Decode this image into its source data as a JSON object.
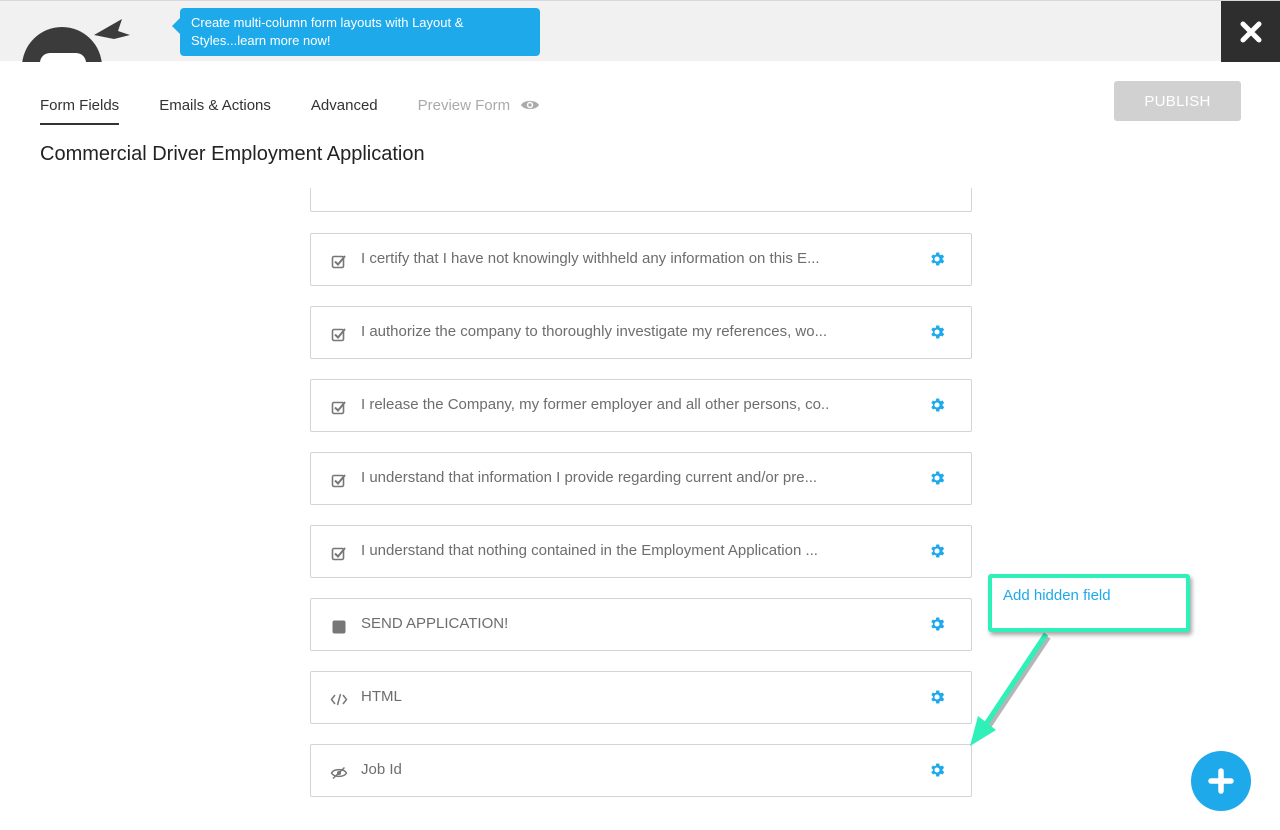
{
  "header": {
    "promo_text": "Create multi-column form layouts with Layout & Styles...learn more now!",
    "close_icon": "close-x-icon"
  },
  "tabs": [
    {
      "label": "Form Fields",
      "active": true
    },
    {
      "label": "Emails & Actions",
      "active": false
    },
    {
      "label": "Advanced",
      "active": false
    },
    {
      "label": "Preview Form",
      "active": false,
      "disabled": true,
      "icon": "eye-icon"
    }
  ],
  "publish_label": "PUBLISH",
  "form_title": "Commercial Driver Employment Application",
  "fields": [
    {
      "icon": "checkbox-icon",
      "label": "I certify that I have not knowingly withheld any information on this E..."
    },
    {
      "icon": "checkbox-icon",
      "label": "I authorize the company to thoroughly investigate my references, wo..."
    },
    {
      "icon": "checkbox-icon",
      "label": "I release the Company, my former employer and all other persons, co.."
    },
    {
      "icon": "checkbox-icon",
      "label": "I understand that information I provide regarding current and/or pre..."
    },
    {
      "icon": "checkbox-icon",
      "label": "I understand that nothing contained in the Employment Application ..."
    },
    {
      "icon": "submit-square-icon",
      "label": "SEND APPLICATION!"
    },
    {
      "icon": "code-icon",
      "label": "HTML"
    },
    {
      "icon": "hidden-eye-icon",
      "label": "Job Id"
    }
  ],
  "annotation": {
    "text": "Add hidden field",
    "border_color": "#2ef0b8"
  },
  "colors": {
    "accent": "#1ea9ea",
    "publish_disabled": "#d1d1d1",
    "close_bg": "#2e2e2e"
  }
}
